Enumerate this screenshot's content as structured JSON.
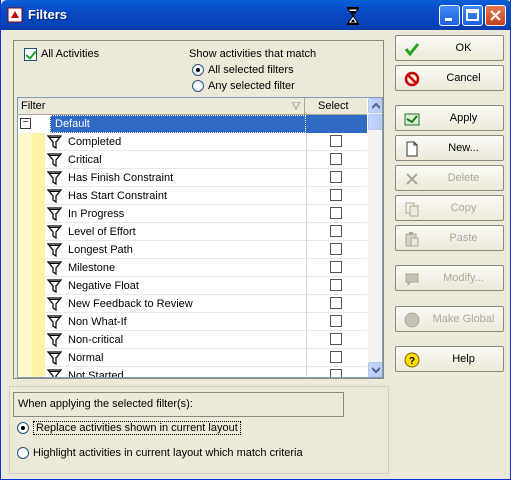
{
  "window": {
    "title": "Filters"
  },
  "options": {
    "all_activities": {
      "label": "All Activities",
      "checked": true
    },
    "show_match_label": "Show activities that match",
    "match_all": "All selected filters",
    "match_any": "Any selected filter",
    "match_selected": "all"
  },
  "grid": {
    "col_filter": "Filter",
    "col_select": "Select",
    "group": "Default",
    "group_toggle": "−",
    "rows": [
      {
        "name": "Completed"
      },
      {
        "name": "Critical"
      },
      {
        "name": "Has Finish Constraint"
      },
      {
        "name": "Has Start Constraint"
      },
      {
        "name": "In Progress"
      },
      {
        "name": "Level of Effort"
      },
      {
        "name": "Longest Path"
      },
      {
        "name": "Milestone"
      },
      {
        "name": "Negative Float"
      },
      {
        "name": "New Feedback to Review"
      },
      {
        "name": "Non What-If"
      },
      {
        "name": "Non-critical"
      },
      {
        "name": "Normal"
      },
      {
        "name": "Not Started"
      }
    ]
  },
  "apply": {
    "heading": "When applying the selected filter(s):",
    "replace": "Replace activities shown in current layout",
    "highlight": "Highlight activities in current layout which match criteria",
    "selected": "replace"
  },
  "buttons": {
    "ok": "OK",
    "cancel": "Cancel",
    "apply": "Apply",
    "new": "New...",
    "delete": "Delete",
    "copy": "Copy",
    "paste": "Paste",
    "modify": "Modify...",
    "make_global": "Make Global",
    "help": "Help"
  },
  "colors": {
    "titlebar": "#0848c5",
    "selection": "#316ac5",
    "ok_check": "#21a121",
    "cancel_red": "#cc0000"
  }
}
